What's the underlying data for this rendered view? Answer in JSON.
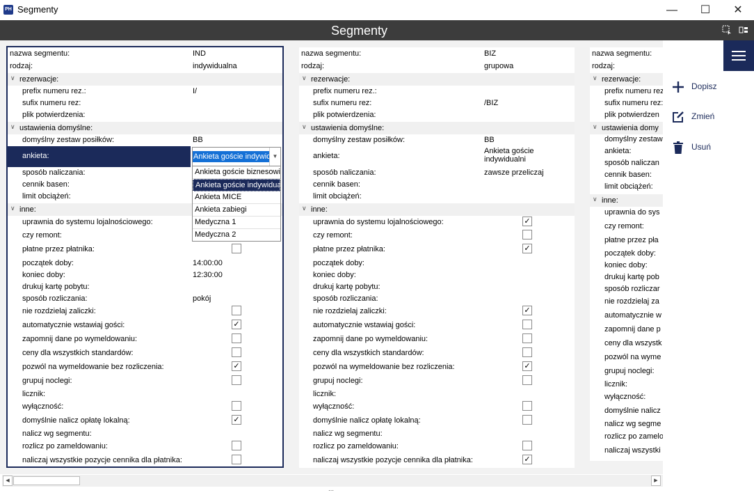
{
  "window": {
    "title": "Segmenty",
    "app_icon": "PH"
  },
  "header": {
    "title": "Segmenty"
  },
  "actions": [
    {
      "icon": "plus-icon",
      "label": "Dopisz"
    },
    {
      "icon": "edit-icon",
      "label": "Zmień"
    },
    {
      "icon": "trash-icon",
      "label": "Usuń"
    }
  ],
  "combo": {
    "value": "Ankieta goście indywidualni",
    "options": [
      "Ankieta goście biznesowi",
      "Ankieta goście indywidualni",
      "Ankieta MICE",
      "Ankieta zabiegi",
      "Medyczna 1",
      "Medyczna 2"
    ],
    "selected_index": 1
  },
  "sections": {
    "rezerwacje": "rezerwacje:",
    "ustawienia": "ustawienia domyślne:",
    "inne": "inne:"
  },
  "labels": {
    "nazwa": "nazwa segmentu:",
    "rodzaj": "rodzaj:",
    "prefix": "prefix numeru rez.:",
    "sufix": "sufix numeru rez:",
    "plik": "plik potwierdzenia:",
    "zestaw": "domyślny zestaw posiłków:",
    "ankieta": "ankieta:",
    "sposob": "sposób naliczania:",
    "cennik": "cennik basen:",
    "limit": "limit obciążeń:",
    "lojal": "uprawnia do systemu lojalnościowego:",
    "remont": "czy remont:",
    "platnik": "płatne przez płatnika:",
    "poczatek": "początek doby:",
    "koniec": "koniec doby:",
    "karta": "drukuj kartę pobytu:",
    "rozliczanie": "sposób rozliczania:",
    "zaliczki": "nie rozdzielaj zaliczki:",
    "wstawiaj": "automatycznie wstawiaj gości:",
    "zapomnij": "zapomnij dane po wymeldowaniu:",
    "ceny": "ceny dla wszystkich standardów:",
    "pozwol": "pozwól na wymeldowanie bez rozliczenia:",
    "grupuj": "grupuj noclegi:",
    "licznik": "licznik:",
    "wylacznosc": "wyłączność:",
    "oplata": "domyślnie nalicz opłatę lokalną:",
    "wg": "nalicz wg segmentu:",
    "zameld": "rozlicz po zameldowaniu:",
    "wszystkie": "naliczaj wszystkie pozycje cennika dla płatnika:"
  },
  "seg1": {
    "nazwa": "IND",
    "rodzaj": "indywidualna",
    "prefix": "I/",
    "sufix": "",
    "zestaw": "BB",
    "poczatek": "14:00:00",
    "koniec": "12:30:00",
    "rozliczanie": "pokój",
    "checks": {
      "platnik": false,
      "zaliczki": false,
      "wstawiaj": true,
      "zapomnij": false,
      "ceny": false,
      "pozwol": true,
      "grupuj": false,
      "wylacznosc": false,
      "oplata": true,
      "zameld": false,
      "wszystkie": false
    }
  },
  "seg2": {
    "nazwa": "BIZ",
    "rodzaj": "grupowa",
    "sufix": "/BIZ",
    "zestaw": "BB",
    "ankieta": "Ankieta goście indywidualni",
    "sposob": "zawsze przeliczaj",
    "checks": {
      "lojal": true,
      "remont": false,
      "platnik": true,
      "zaliczki": true,
      "wstawiaj": false,
      "zapomnij": false,
      "ceny": false,
      "pozwol": true,
      "grupuj": false,
      "wylacznosc": false,
      "oplata": false,
      "zameld": false,
      "wszystkie": true
    }
  },
  "seg3_labels": {
    "nazwa": "nazwa segmentu:",
    "rodzaj": "rodzaj:",
    "rezerwacje": "rezerwacje:",
    "prefix": "prefix numeru rez.:",
    "sufix": "sufix numeru rez:",
    "plik": "plik potwierdzen",
    "ustawienia": "ustawienia domy",
    "zestaw": "domyślny zestaw",
    "ankieta": "ankieta:",
    "sposob": "sposób naliczan",
    "cennik": "cennik basen:",
    "limit": "limit obciążeń:",
    "inne": "inne:",
    "lojal": "uprawnia do sys",
    "remont": "czy remont:",
    "platnik": "płatne przez pła",
    "poczatek": "początek doby:",
    "koniec": "koniec doby:",
    "karta": "drukuj kartę pob",
    "rozliczanie": "sposób rozliczar",
    "zaliczki": "nie rozdzielaj za",
    "wstawiaj": "automatycznie w",
    "zapomnij": "zapomnij dane p",
    "ceny": "ceny dla wszystk",
    "pozwol": "pozwól na wyme",
    "grupuj": "grupuj noclegi:",
    "licznik": "licznik:",
    "wylacznosc": "wyłączność:",
    "oplata": "domyślnie nalicz",
    "wg": "nalicz wg segme",
    "zameld": "rozlicz po zamelo",
    "wszystkie": "naliczaj wszystki"
  },
  "colors": {
    "accent": "#1b2a5a",
    "header": "#3c3c3c",
    "selection": "#1470d6"
  }
}
